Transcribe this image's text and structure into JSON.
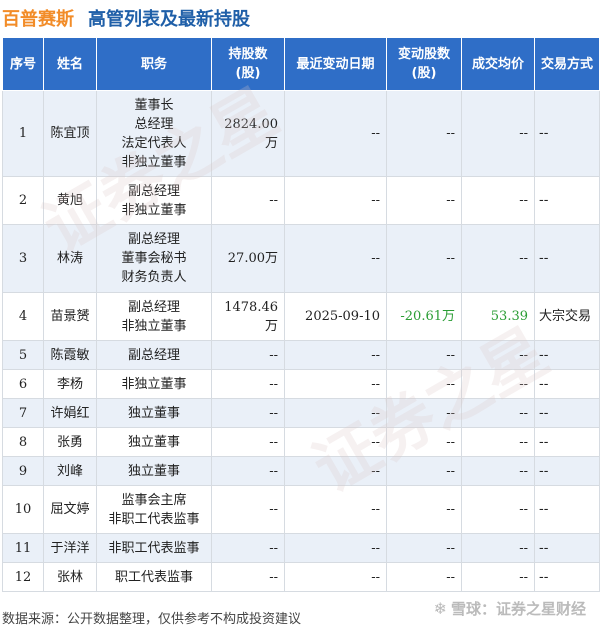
{
  "header": {
    "company": "百普赛斯",
    "title": "高管列表及最新持股"
  },
  "columns": [
    "序号",
    "姓名",
    "职务",
    "持股数\n(股)",
    "最近变动日期",
    "变动股数\n(股)",
    "成交均价",
    "交易方式"
  ],
  "rows": [
    {
      "idx": "1",
      "name": "陈宜顶",
      "roles": [
        "董事长",
        "总经理",
        "法定代表人",
        "非独立董事"
      ],
      "shares": "2824.00万",
      "date": "--",
      "change": "--",
      "price": "--",
      "method": "--"
    },
    {
      "idx": "2",
      "name": "黄旭",
      "roles": [
        "副总经理",
        "非独立董事"
      ],
      "shares": "--",
      "date": "--",
      "change": "--",
      "price": "--",
      "method": "--"
    },
    {
      "idx": "3",
      "name": "林涛",
      "roles": [
        "副总经理",
        "董事会秘书",
        "财务负责人"
      ],
      "shares": "27.00万",
      "date": "--",
      "change": "--",
      "price": "--",
      "method": "--"
    },
    {
      "idx": "4",
      "name": "苗景赟",
      "roles": [
        "副总经理",
        "非独立董事"
      ],
      "shares": "1478.46万",
      "date": "2025-09-10",
      "change": "-20.61万",
      "price": "53.39",
      "method": "大宗交易"
    },
    {
      "idx": "5",
      "name": "陈霞敏",
      "roles": [
        "副总经理"
      ],
      "shares": "--",
      "date": "--",
      "change": "--",
      "price": "--",
      "method": "--"
    },
    {
      "idx": "6",
      "name": "李杨",
      "roles": [
        "非独立董事"
      ],
      "shares": "--",
      "date": "--",
      "change": "--",
      "price": "--",
      "method": "--"
    },
    {
      "idx": "7",
      "name": "许娟红",
      "roles": [
        "独立董事"
      ],
      "shares": "--",
      "date": "--",
      "change": "--",
      "price": "--",
      "method": "--"
    },
    {
      "idx": "8",
      "name": "张勇",
      "roles": [
        "独立董事"
      ],
      "shares": "--",
      "date": "--",
      "change": "--",
      "price": "--",
      "method": "--"
    },
    {
      "idx": "9",
      "name": "刘峰",
      "roles": [
        "独立董事"
      ],
      "shares": "--",
      "date": "--",
      "change": "--",
      "price": "--",
      "method": "--"
    },
    {
      "idx": "10",
      "name": "屈文婷",
      "roles": [
        "监事会主席",
        "非职工代表监事"
      ],
      "shares": "--",
      "date": "--",
      "change": "--",
      "price": "--",
      "method": "--"
    },
    {
      "idx": "11",
      "name": "于洋洋",
      "roles": [
        "非职工代表监事"
      ],
      "shares": "--",
      "date": "--",
      "change": "--",
      "price": "--",
      "method": "--"
    },
    {
      "idx": "12",
      "name": "张林",
      "roles": [
        "职工代表监事"
      ],
      "shares": "--",
      "date": "--",
      "change": "--",
      "price": "--",
      "method": "--"
    }
  ],
  "footer": {
    "source": "数据来源：公开数据整理，仅供参考不构成投资建议",
    "brand": "雪球：证券之星财经"
  },
  "colors": {
    "header_bg": "#2f6ec7",
    "company": "#f28c28",
    "title": "#1f5fa8",
    "change_color": "#2a9d34"
  },
  "watermark": "证券之星"
}
